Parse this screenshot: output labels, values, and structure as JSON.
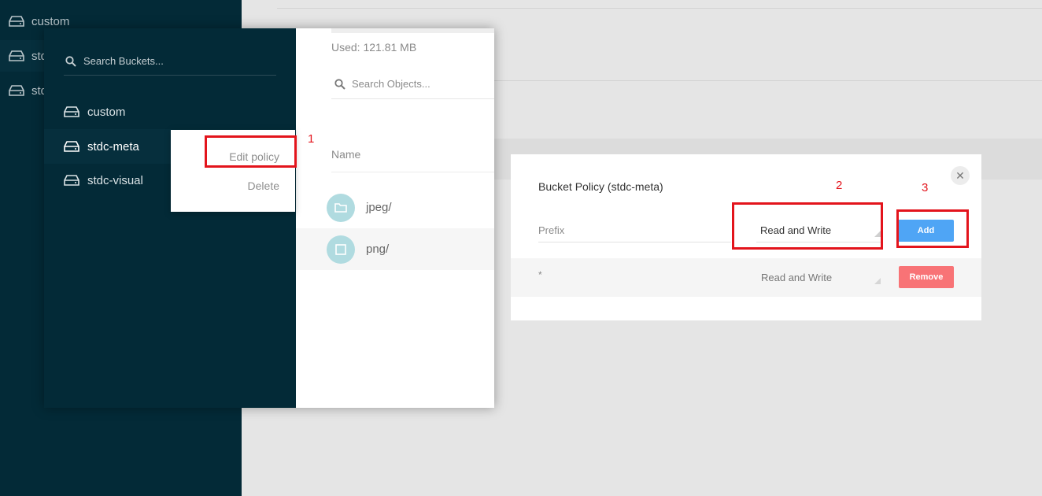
{
  "background": {
    "sidebar": {
      "items": [
        {
          "label": "custom",
          "icon": "drive-icon"
        },
        {
          "label": "stdc-meta",
          "icon": "drive-icon"
        },
        {
          "label": "stdc-visual",
          "icon": "drive-icon"
        }
      ]
    }
  },
  "front_window": {
    "sidebar": {
      "search_placeholder": "Search Buckets...",
      "buckets": [
        {
          "label": "custom",
          "icon": "drive-icon"
        },
        {
          "label": "stdc-meta",
          "icon": "drive-icon",
          "selected": true
        },
        {
          "label": "stdc-visual",
          "icon": "drive-icon"
        }
      ]
    },
    "main": {
      "used": "Used: 121.81 MB",
      "search_placeholder": "Search Objects...",
      "column_name": "Name",
      "objects": [
        {
          "label": "jpeg/",
          "icon": "folder-icon"
        },
        {
          "label": "png/",
          "icon": "file-icon"
        }
      ]
    },
    "context_menu": {
      "edit": "Edit policy",
      "delete": "Delete"
    }
  },
  "annotations": {
    "numbers": [
      "1",
      "2",
      "3"
    ],
    "color": "#e3141c"
  },
  "policy_modal": {
    "title": "Bucket Policy (stdc-meta)",
    "prefix_placeholder": "Prefix",
    "policy_value": "Read and Write",
    "add_label": "Add",
    "rows": [
      {
        "prefix": "*",
        "policy": "Read and Write",
        "remove_label": "Remove"
      }
    ]
  },
  "colors": {
    "sidebar_bg": "#032a37",
    "add_button": "#4fa5f5",
    "remove_button": "#f87376",
    "folder_icon_bg": "#b0dbe0"
  }
}
